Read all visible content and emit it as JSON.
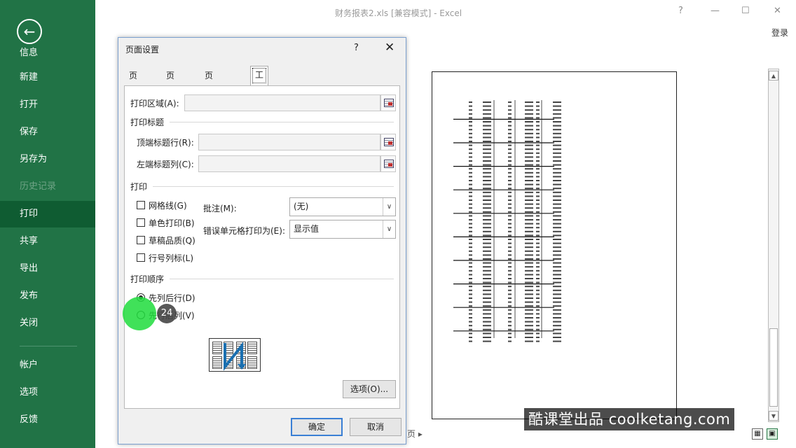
{
  "window": {
    "title": "财务报表2.xls  [兼容模式] - Excel",
    "help": "?",
    "minimize": "—",
    "maximize": "☐",
    "close": "✕",
    "login": "登录"
  },
  "sidebar": {
    "back_icon": "←",
    "back_label": "信息",
    "items": [
      {
        "label": "新建",
        "state": "normal"
      },
      {
        "label": "打开",
        "state": "normal"
      },
      {
        "label": "保存",
        "state": "normal"
      },
      {
        "label": "另存为",
        "state": "normal"
      },
      {
        "label": "历史记录",
        "state": "disabled"
      },
      {
        "label": "打印",
        "state": "active"
      },
      {
        "label": "共享",
        "state": "normal"
      },
      {
        "label": "导出",
        "state": "normal"
      },
      {
        "label": "发布",
        "state": "normal"
      },
      {
        "label": "关闭",
        "state": "normal"
      }
    ],
    "bottom_items": [
      {
        "label": "帐户"
      },
      {
        "label": "选项"
      },
      {
        "label": "反馈"
      }
    ],
    "colors": {
      "background": "#217346",
      "active": "#0f5c32"
    }
  },
  "preview": {
    "page_nav": "页  ▸",
    "watermark": "酷课堂出品 coolketang.com"
  },
  "dialog": {
    "title": "页面设置",
    "help": "?",
    "close": "✕",
    "tabs": [
      {
        "label": "页面"
      },
      {
        "label": "页边距"
      },
      {
        "label": "页眉/页脚"
      },
      {
        "label": "工作表",
        "active": true
      }
    ],
    "print_area_label": "打印区域(A):",
    "print_titles_heading": "打印标题",
    "rows_to_repeat_label": "顶端标题行(R):",
    "cols_to_repeat_label": "左端标题列(C):",
    "print_heading": "打印",
    "checkboxes": [
      {
        "label": "网格线(G)",
        "checked": false
      },
      {
        "label": "单色打印(B)",
        "checked": false
      },
      {
        "label": "草稿品质(Q)",
        "checked": false
      },
      {
        "label": "行号列标(L)",
        "checked": false
      }
    ],
    "comments_label": "批注(M):",
    "comments_value": "(无)",
    "errors_label": "错误单元格打印为(E):",
    "errors_value": "显示值",
    "page_order_heading": "打印顺序",
    "radios": [
      {
        "label": "先列后行(D)",
        "checked": true
      },
      {
        "label": "先行后列(V)",
        "checked": false
      }
    ],
    "options_button": "选项(O)...",
    "ok_button": "确定",
    "cancel_button": "取消"
  },
  "tutorial": {
    "step": "24"
  }
}
